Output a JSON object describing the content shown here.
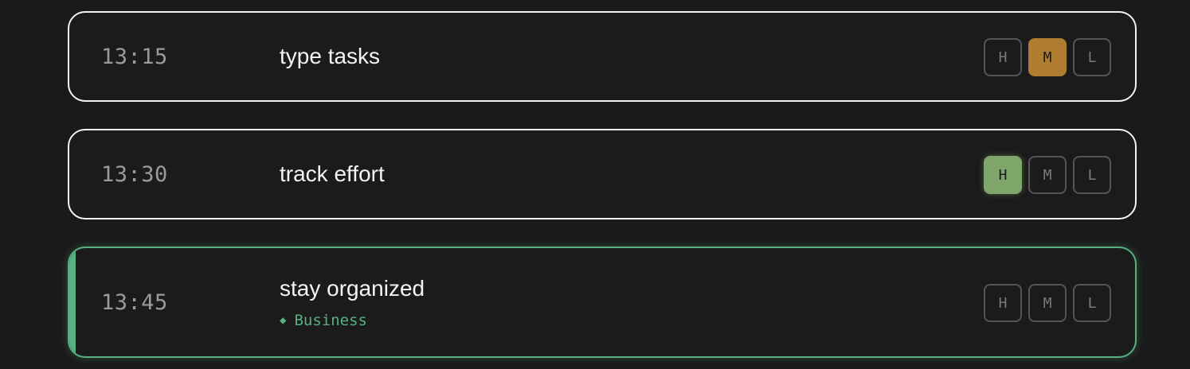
{
  "tasks": [
    {
      "time": "13:15",
      "title": "type tasks",
      "priority_labels": [
        "H",
        "M",
        "L"
      ],
      "selected_priority": "M"
    },
    {
      "time": "13:30",
      "title": "track effort",
      "priority_labels": [
        "H",
        "M",
        "L"
      ],
      "selected_priority": "H"
    },
    {
      "time": "13:45",
      "title": "stay organized",
      "tag": {
        "icon": "diamond-icon",
        "label": "Business"
      },
      "priority_labels": [
        "H",
        "M",
        "L"
      ],
      "selected_priority": null,
      "highlighted": true
    }
  ],
  "colors": {
    "background": "#1a1a1a",
    "card_border": "#f2f2f2",
    "highlight_green": "#57b07f",
    "priority_medium": "#b07c2f",
    "priority_high": "#7ea66a"
  }
}
